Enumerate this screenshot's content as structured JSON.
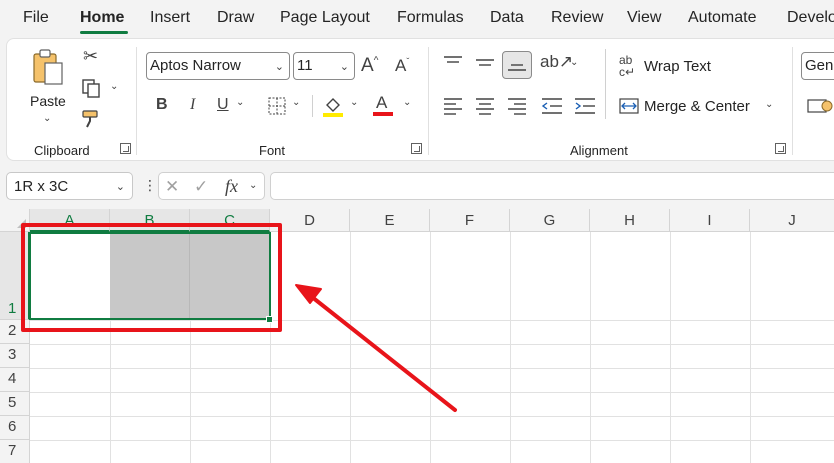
{
  "menu": {
    "items": [
      "File",
      "Home",
      "Insert",
      "Draw",
      "Page Layout",
      "Formulas",
      "Data",
      "Review",
      "View",
      "Automate",
      "Develo"
    ],
    "active": "Home"
  },
  "ribbon": {
    "clipboard": {
      "paste_label": "Paste",
      "group_label": "Clipboard"
    },
    "font": {
      "font_name": "Aptos Narrow",
      "font_size": "11",
      "group_label": "Font",
      "bold": "B",
      "italic": "I",
      "underline": "U",
      "font_color_glyph": "A"
    },
    "alignment": {
      "wrap_text": "Wrap Text",
      "merge_center": "Merge & Center",
      "group_label": "Alignment"
    },
    "number": {
      "format": "Gene"
    }
  },
  "formula_bar": {
    "name_box": "1R x 3C",
    "fx_label": "fx",
    "formula": ""
  },
  "grid": {
    "columns": [
      "A",
      "B",
      "C",
      "D",
      "E",
      "F",
      "G",
      "H",
      "I",
      "J"
    ],
    "selected_columns": [
      "A",
      "B",
      "C"
    ],
    "rows": [
      "1",
      "2",
      "3",
      "4",
      "5",
      "6",
      "7"
    ],
    "selected_rows": [
      "1"
    ]
  },
  "colors": {
    "accent": "#107c41",
    "highlight": "#e8141a",
    "selection_fill": "#c8c8c8"
  }
}
